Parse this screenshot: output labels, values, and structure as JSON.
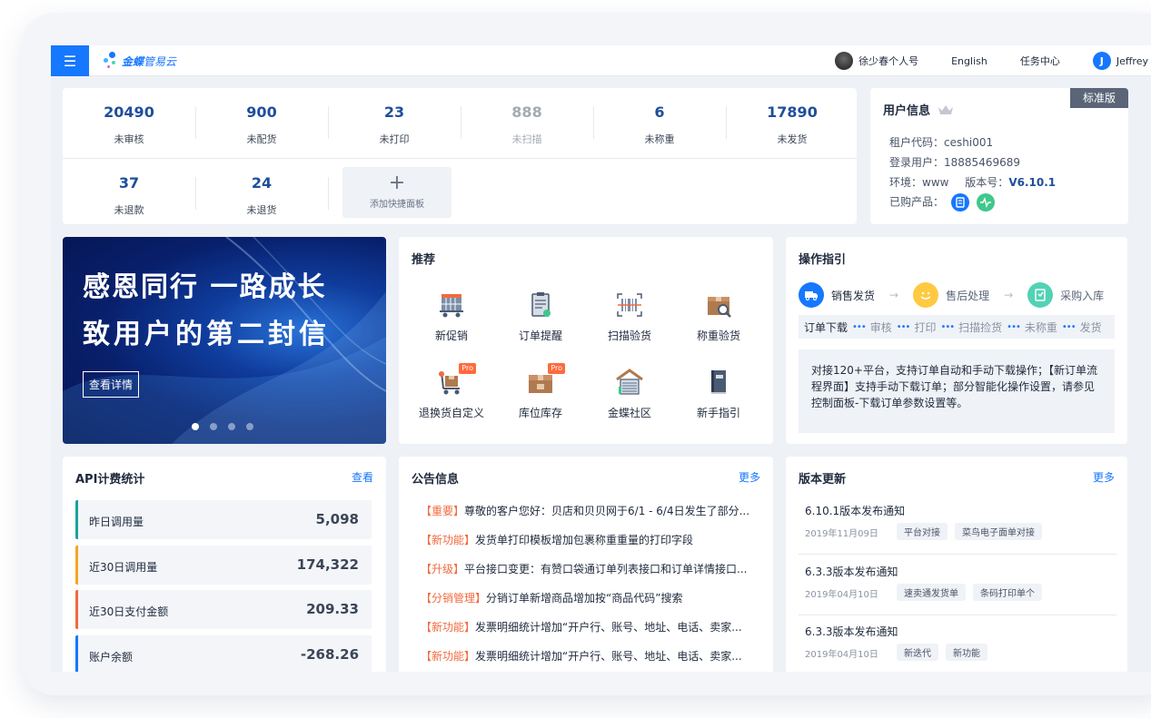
{
  "topbar": {
    "brand_main": "金蝶",
    "brand_sub": "管易云",
    "account_label": "徐少春个人号",
    "language": "English",
    "task_center": "任务中心",
    "user_initial": "J",
    "user_name": "Jeffrey"
  },
  "stats": [
    {
      "value": "20490",
      "label": "未审核",
      "muted": false
    },
    {
      "value": "900",
      "label": "未配货",
      "muted": false
    },
    {
      "value": "23",
      "label": "未打印",
      "muted": false
    },
    {
      "value": "888",
      "label": "未扫描",
      "muted": true
    },
    {
      "value": "6",
      "label": "未称重",
      "muted": false
    },
    {
      "value": "17890",
      "label": "未发货",
      "muted": false
    },
    {
      "value": "37",
      "label": "未退款",
      "muted": false
    },
    {
      "value": "24",
      "label": "未退货",
      "muted": false
    }
  ],
  "add_panel": {
    "plus": "+",
    "label": "添加快捷面板"
  },
  "user_info": {
    "title": "用户信息",
    "edition": "标准版",
    "tenant_label": "租户代码：",
    "tenant": "ceshi001",
    "login_label": "登录用户：",
    "login": "18885469689",
    "env_label": "环境：",
    "env": "www",
    "ver_label": "版本号：",
    "version": "V6.10.1",
    "products_label": "已购产品："
  },
  "banner": {
    "line1": "感恩同行  一路成长",
    "line2": "致用户的第二封信",
    "button": "查看详情",
    "slides": 4,
    "active_slide": 0
  },
  "recommend": {
    "title": "推荐",
    "pro_label": "Pro",
    "items": [
      {
        "label": "新促销",
        "icon": "cart-icon",
        "pro": false
      },
      {
        "label": "订单提醒",
        "icon": "clipboard-icon",
        "pro": false
      },
      {
        "label": "扫描验货",
        "icon": "barcode-icon",
        "pro": false
      },
      {
        "label": "称重验货",
        "icon": "box-search-icon",
        "pro": false
      },
      {
        "label": "退换货自定义",
        "icon": "return-cart-icon",
        "pro": true
      },
      {
        "label": "库位库存",
        "icon": "stock-box-icon",
        "pro": true
      },
      {
        "label": "金蝶社区",
        "icon": "warehouse-icon",
        "pro": false
      },
      {
        "label": "新手指引",
        "icon": "book-icon",
        "pro": false
      }
    ]
  },
  "guide": {
    "title": "操作指引",
    "flow": [
      {
        "label": "销售发货",
        "color": "#1677ff"
      },
      {
        "label": "售后处理",
        "color": "#ffc940"
      },
      {
        "label": "采购入库",
        "color": "#52d2b5"
      }
    ],
    "arrow": "→",
    "steps": [
      "订单下载",
      "审核",
      "打印",
      "扫描捡货",
      "未称重",
      "发货"
    ],
    "step_sep": "•••",
    "description": "对接120+平台，支持订单自动和手动下载操作；【新订单流程界面】支持手动下载订单；部分智能化操作设置，请参见控制面板-下载订单参数设置等。"
  },
  "api": {
    "title": "API计费统计",
    "more": "查看",
    "rows": [
      {
        "label": "昨日调用量",
        "value": "5,098",
        "color": "#1aa39a"
      },
      {
        "label": "近30日调用量",
        "value": "174,322",
        "color": "#f5a623"
      },
      {
        "label": "近30日支付金额",
        "value": "209.33",
        "color": "#f26a3e"
      },
      {
        "label": "账户余额",
        "value": "-268.26",
        "color": "#1677ff"
      }
    ]
  },
  "notice": {
    "title": "公告信息",
    "more": "更多",
    "items": [
      {
        "tag": "【重要】",
        "text": "尊敬的客户您好：贝店和贝贝网于6/1 - 6/4日发生了部分..."
      },
      {
        "tag": "【新功能】",
        "text": "发货单打印模板增加包裹称重重量的打印字段"
      },
      {
        "tag": "【升级】",
        "text": "平台接口变更：有赞口袋通订单列表接口和订单详情接口..."
      },
      {
        "tag": "【分销管理】",
        "text": "分销订单新增商品增加按“商品代码”搜索"
      },
      {
        "tag": "【新功能】",
        "text": "发票明细统计增加“开户行、账号、地址、电话、卖家..."
      },
      {
        "tag": "【新功能】",
        "text": "发票明细统计增加“开户行、账号、地址、电话、卖家..."
      }
    ]
  },
  "versions": {
    "title": "版本更新",
    "more": "更多",
    "items": [
      {
        "title": "6.10.1版本发布通知",
        "date": "2019年11月09日",
        "tags": [
          "平台对接",
          "菜鸟电子面单对接"
        ]
      },
      {
        "title": "6.3.3版本发布通知",
        "date": "2019年04月10日",
        "tags": [
          "速卖通发货单",
          "条码打印单个"
        ]
      },
      {
        "title": "6.3.3版本发布通知",
        "date": "2019年04月10日",
        "tags": [
          "新迭代",
          "新功能"
        ]
      }
    ]
  }
}
